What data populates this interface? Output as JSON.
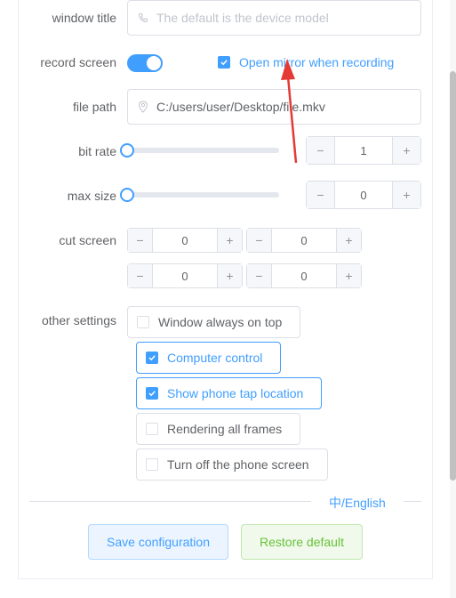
{
  "form": {
    "window_title": {
      "label": "window title",
      "placeholder": "The default is the device model"
    },
    "record_screen": {
      "label": "record screen",
      "enabled": true,
      "mirror_checkbox": {
        "label": "Open mirror when recording",
        "checked": true
      }
    },
    "file_path": {
      "label": "file path",
      "value": "C:/users/user/Desktop/file.mkv"
    },
    "bit_rate": {
      "label": "bit rate",
      "slider_level": 0,
      "value": "1",
      "minus": "−",
      "plus": "+"
    },
    "max_size": {
      "label": "max size",
      "slider_level": 0,
      "value": "0",
      "minus": "−",
      "plus": "+"
    },
    "cut_screen": {
      "label": "cut screen",
      "minus": "−",
      "plus": "+",
      "values": [
        "0",
        "0",
        "0",
        "0"
      ]
    },
    "other_settings": {
      "label": "other settings",
      "options": [
        {
          "label": "Window always on top",
          "checked": false
        },
        {
          "label": "Computer control",
          "checked": true
        },
        {
          "label": "Show phone tap location",
          "checked": true
        },
        {
          "label": "Rendering all frames",
          "checked": false
        },
        {
          "label": "Turn off the phone screen",
          "checked": false
        }
      ]
    }
  },
  "language_toggle": "中/English",
  "buttons": {
    "save": "Save configuration",
    "restore": "Restore default"
  },
  "icons": {
    "phone": "phone-icon",
    "location": "location-pin-icon",
    "check": "check-icon",
    "annotation": "red-arrow-annotation"
  },
  "colors": {
    "accent": "#409eff",
    "success": "#67c23a",
    "annotation": "#e53935"
  }
}
